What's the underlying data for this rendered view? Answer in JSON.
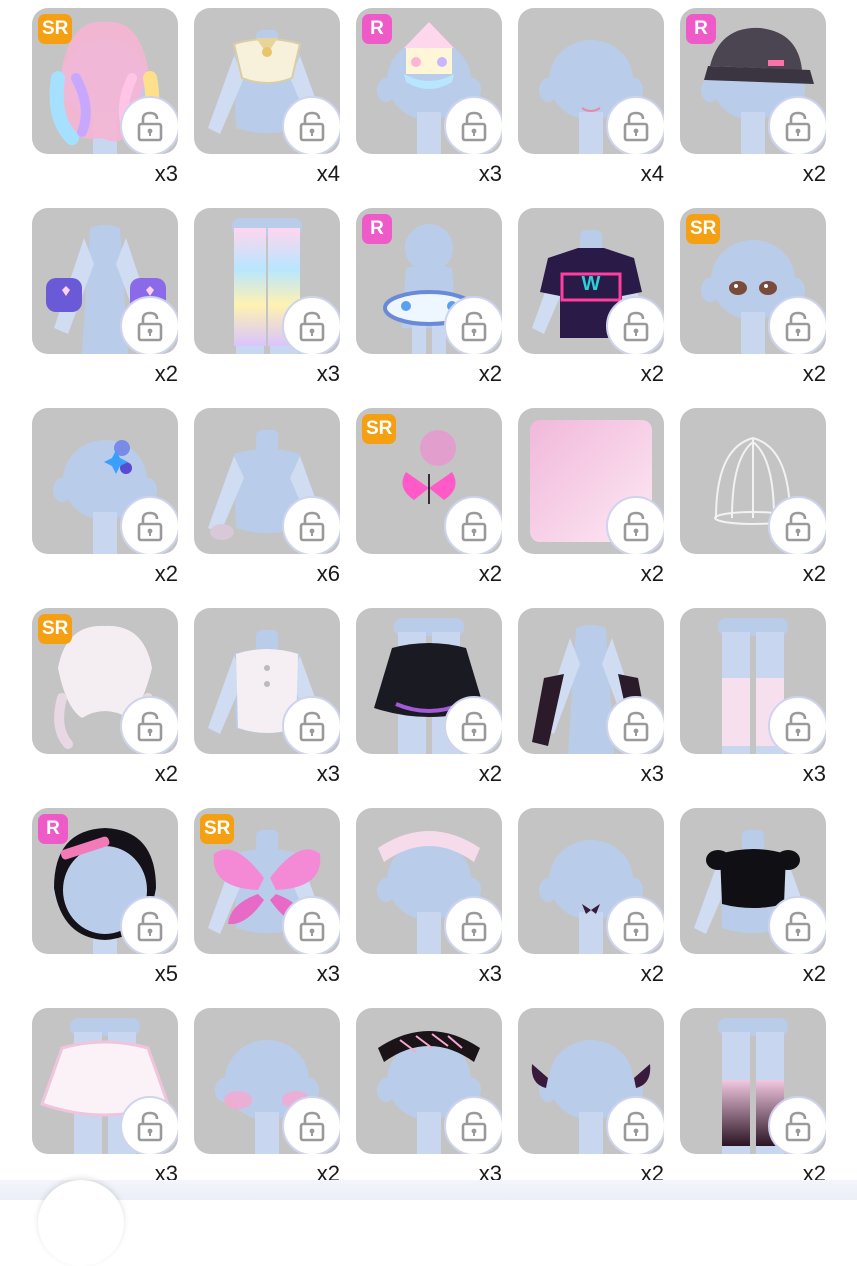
{
  "items": [
    {
      "name": "pastel-rainbow-twintail-hair",
      "rarity": "SR",
      "count": "x3",
      "base": "head",
      "item": "hair-rainbow"
    },
    {
      "name": "cream-ribbon-collar-top",
      "rarity": "",
      "count": "x4",
      "base": "torso",
      "item": "collar"
    },
    {
      "name": "carousel-hat",
      "rarity": "R",
      "count": "x3",
      "base": "head",
      "item": "carousel"
    },
    {
      "name": "blush-mouth",
      "rarity": "",
      "count": "x4",
      "base": "head",
      "item": "mouth"
    },
    {
      "name": "black-cap",
      "rarity": "R",
      "count": "x2",
      "base": "head",
      "item": "cap"
    },
    {
      "name": "purple-heart-gloves",
      "rarity": "",
      "count": "x2",
      "base": "arms",
      "item": "gloves"
    },
    {
      "name": "rainbow-cloud-leggings",
      "rarity": "",
      "count": "x3",
      "base": "legs",
      "item": "leggings"
    },
    {
      "name": "bubble-float-accessory",
      "rarity": "R",
      "count": "x2",
      "base": "body",
      "item": "float"
    },
    {
      "name": "graffiti-tee",
      "rarity": "",
      "count": "x2",
      "base": "torso",
      "item": "tee"
    },
    {
      "name": "brown-eyes",
      "rarity": "SR",
      "count": "x2",
      "base": "head",
      "item": "eyes"
    },
    {
      "name": "space-hairclips",
      "rarity": "",
      "count": "x2",
      "base": "head",
      "item": "clips"
    },
    {
      "name": "lace-cuffs",
      "rarity": "",
      "count": "x6",
      "base": "torso",
      "item": "cuffs"
    },
    {
      "name": "glowing-butterfly",
      "rarity": "SR",
      "count": "x2",
      "base": "none",
      "item": "butterfly-glow"
    },
    {
      "name": "pink-background",
      "rarity": "",
      "count": "x2",
      "base": "none",
      "item": "bg-square"
    },
    {
      "name": "silver-cage-headpiece",
      "rarity": "",
      "count": "x2",
      "base": "none",
      "item": "cage"
    },
    {
      "name": "white-wavy-hair",
      "rarity": "SR",
      "count": "x2",
      "base": "none",
      "item": "hair-white"
    },
    {
      "name": "white-ruffle-blouse",
      "rarity": "",
      "count": "x3",
      "base": "torso",
      "item": "blouse"
    },
    {
      "name": "black-tutu-skirt",
      "rarity": "",
      "count": "x2",
      "base": "legs",
      "item": "skirt-black"
    },
    {
      "name": "black-arm-warmers",
      "rarity": "",
      "count": "x3",
      "base": "arms",
      "item": "warmers"
    },
    {
      "name": "pink-leg-warmers",
      "rarity": "",
      "count": "x3",
      "base": "legs",
      "item": "legwarmers-pink"
    },
    {
      "name": "black-ruffle-bonnet",
      "rarity": "R",
      "count": "x5",
      "base": "head",
      "item": "bonnet"
    },
    {
      "name": "pink-butterfly-wings",
      "rarity": "SR",
      "count": "x3",
      "base": "torso",
      "item": "wings"
    },
    {
      "name": "pink-braid-headband",
      "rarity": "",
      "count": "x3",
      "base": "head",
      "item": "braid-pink"
    },
    {
      "name": "bow-choker",
      "rarity": "",
      "count": "x2",
      "base": "head",
      "item": "choker"
    },
    {
      "name": "black-puff-top",
      "rarity": "",
      "count": "x2",
      "base": "torso",
      "item": "puff-top"
    },
    {
      "name": "white-petal-skirt",
      "rarity": "",
      "count": "x3",
      "base": "legs",
      "item": "skirt-white"
    },
    {
      "name": "rosy-cheeks",
      "rarity": "",
      "count": "x2",
      "base": "head",
      "item": "cheeks"
    },
    {
      "name": "black-braid-headband",
      "rarity": "",
      "count": "x3",
      "base": "head",
      "item": "braid-black"
    },
    {
      "name": "butterfly-hairclips",
      "rarity": "",
      "count": "x2",
      "base": "head",
      "item": "butterfly-clips"
    },
    {
      "name": "ombre-leg-warmers",
      "rarity": "",
      "count": "x2",
      "base": "legs",
      "item": "legwarmers-black"
    }
  ],
  "colors": {
    "tile": "#c4c4c4",
    "mannequin": "#b9cdea",
    "sr": "#f5a012",
    "r": "#ee5ac8"
  }
}
